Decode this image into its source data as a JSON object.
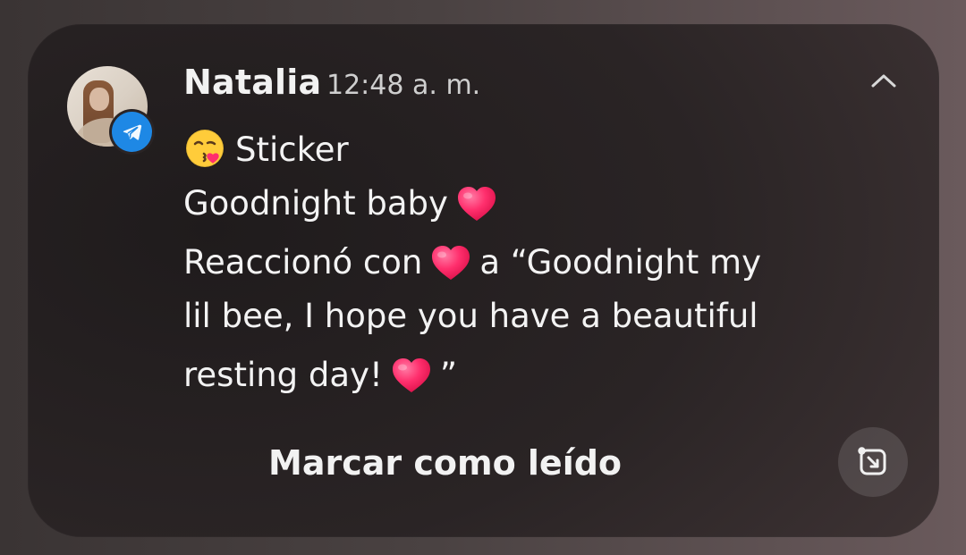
{
  "notification": {
    "sender": "Natalia",
    "time": "12:48 a. m.",
    "app_badge_icon": "telegram-icon",
    "messages": {
      "line1_text": "Sticker",
      "line2_text": "Goodnight baby",
      "line3_prefix": "Reaccionó con",
      "line3_suffix": "a “Goodnight my",
      "line4_text": "lil bee, I hope you have a beautiful",
      "line5_prefix": "resting day!",
      "line5_suffix": "”"
    },
    "actions": {
      "mark_read_label": "Marcar como leído"
    },
    "colors": {
      "card_bg": "#2a2425",
      "text_primary": "#f3f3f3",
      "text_secondary": "#cfcfcf",
      "telegram_blue": "#1e88e5",
      "heart_pink": "#ff2f6d"
    }
  }
}
